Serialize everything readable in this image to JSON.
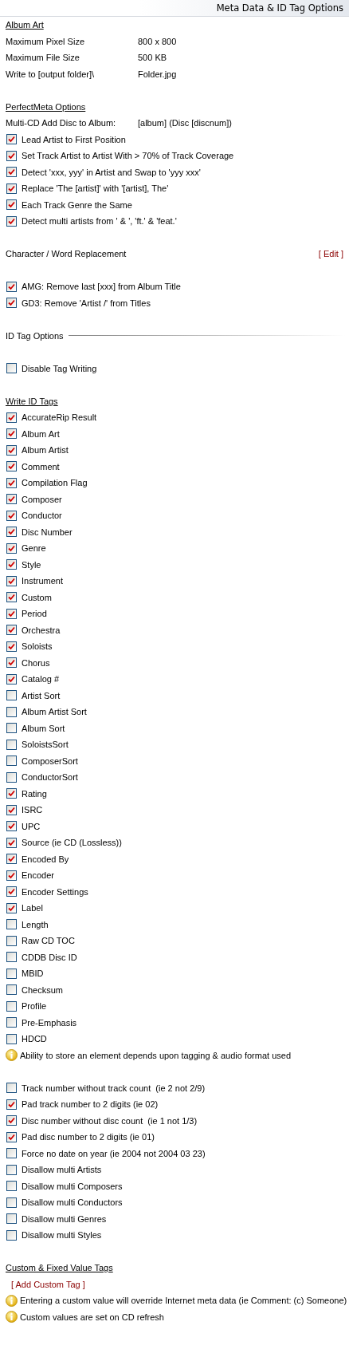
{
  "header": {
    "title": "Meta Data & ID Tag Options"
  },
  "sections": [
    {
      "items": [
        {
          "kind": "heading",
          "text": "Album Art"
        },
        {
          "kind": "field",
          "label": "Maximum Pixel Size",
          "value": "800 x 800"
        },
        {
          "kind": "field",
          "label": "Maximum File Size",
          "value": "500 KB"
        },
        {
          "kind": "field",
          "label": "Write to [output folder]\\",
          "value": "Folder.jpg"
        }
      ]
    },
    {
      "items": [
        {
          "kind": "heading",
          "text": "PerfectMeta Options"
        },
        {
          "kind": "field",
          "label": "Multi-CD Add Disc to Album:",
          "value": "[album] (Disc [discnum])"
        },
        {
          "kind": "check",
          "label": "Lead Artist to First Position",
          "checked": true
        },
        {
          "kind": "check",
          "label": "Set Track Artist to Artist With > 70% of Track Coverage",
          "checked": true
        },
        {
          "kind": "check",
          "label": "Detect 'xxx, yyy' in Artist and Swap to 'yyy xxx'",
          "checked": true
        },
        {
          "kind": "check",
          "label": "Replace 'The [artist]' with '[artist], The'",
          "checked": true
        },
        {
          "kind": "check",
          "label": "Each Track Genre the Same",
          "checked": true
        },
        {
          "kind": "check",
          "label": "Detect multi artists from ' & ', 'ft.' & 'feat.'",
          "checked": true
        }
      ]
    },
    {
      "items": [
        {
          "kind": "link_row",
          "label": "Character / Word Replacement",
          "link": "[ Edit ]"
        }
      ]
    },
    {
      "items": [
        {
          "kind": "check",
          "label": "AMG: Remove last [xxx] from Album Title",
          "checked": true
        },
        {
          "kind": "check",
          "label": "GD3: Remove 'Artist /' from Titles",
          "checked": true
        }
      ]
    },
    {
      "items": [
        {
          "kind": "rule_heading",
          "text": "ID Tag Options"
        }
      ]
    },
    {
      "items": [
        {
          "kind": "check",
          "label": "Disable Tag Writing",
          "checked": false
        }
      ]
    },
    {
      "items": [
        {
          "kind": "heading",
          "text": "Write ID Tags"
        },
        {
          "kind": "check",
          "label": "AccurateRip Result",
          "checked": true
        },
        {
          "kind": "check",
          "label": "Album Art",
          "checked": true
        },
        {
          "kind": "check",
          "label": "Album Artist",
          "checked": true
        },
        {
          "kind": "check",
          "label": "Comment",
          "checked": true
        },
        {
          "kind": "check",
          "label": "Compilation Flag",
          "checked": true
        },
        {
          "kind": "check",
          "label": "Composer",
          "checked": true
        },
        {
          "kind": "check",
          "label": "Conductor",
          "checked": true
        },
        {
          "kind": "check",
          "label": "Disc Number",
          "checked": true
        },
        {
          "kind": "check",
          "label": "Genre",
          "checked": true
        },
        {
          "kind": "check",
          "label": "Style",
          "checked": true
        },
        {
          "kind": "check",
          "label": "Instrument",
          "checked": true
        },
        {
          "kind": "check",
          "label": "Custom",
          "checked": true
        },
        {
          "kind": "check",
          "label": "Period",
          "checked": true
        },
        {
          "kind": "check",
          "label": "Orchestra",
          "checked": true
        },
        {
          "kind": "check",
          "label": "Soloists",
          "checked": true
        },
        {
          "kind": "check",
          "label": "Chorus",
          "checked": true
        },
        {
          "kind": "check",
          "label": "Catalog #",
          "checked": true
        },
        {
          "kind": "check",
          "label": "Artist Sort",
          "checked": false
        },
        {
          "kind": "check",
          "label": "Album Artist Sort",
          "checked": false
        },
        {
          "kind": "check",
          "label": "Album Sort",
          "checked": false
        },
        {
          "kind": "check",
          "label": "SoloistsSort",
          "checked": false
        },
        {
          "kind": "check",
          "label": "ComposerSort",
          "checked": false
        },
        {
          "kind": "check",
          "label": "ConductorSort",
          "checked": false
        },
        {
          "kind": "check",
          "label": "Rating",
          "checked": true
        },
        {
          "kind": "check",
          "label": "ISRC",
          "checked": true
        },
        {
          "kind": "check",
          "label": "UPC",
          "checked": true
        },
        {
          "kind": "check",
          "label": "Source (ie CD (Lossless))",
          "checked": true
        },
        {
          "kind": "check",
          "label": "Encoded By",
          "checked": true
        },
        {
          "kind": "check",
          "label": "Encoder",
          "checked": true
        },
        {
          "kind": "check",
          "label": "Encoder Settings",
          "checked": true
        },
        {
          "kind": "check",
          "label": "Label",
          "checked": true
        },
        {
          "kind": "check",
          "label": "Length",
          "checked": false
        },
        {
          "kind": "check",
          "label": "Raw CD TOC",
          "checked": false
        },
        {
          "kind": "check",
          "label": "CDDB Disc ID",
          "checked": false
        },
        {
          "kind": "check",
          "label": "MBID",
          "checked": false
        },
        {
          "kind": "check",
          "label": "Checksum",
          "checked": false
        },
        {
          "kind": "check",
          "label": "Profile",
          "checked": false
        },
        {
          "kind": "check",
          "label": "Pre-Emphasis",
          "checked": false
        },
        {
          "kind": "check",
          "label": "HDCD",
          "checked": false
        },
        {
          "kind": "note",
          "text": "Ability to store an element depends upon tagging & audio format used"
        }
      ]
    },
    {
      "items": [
        {
          "kind": "check",
          "label": "Track number without track count  (ie 2 not 2/9)",
          "checked": false
        },
        {
          "kind": "check",
          "label": "Pad track number to 2 digits (ie 02)",
          "checked": true
        },
        {
          "kind": "check",
          "label": "Disc number without disc count  (ie 1 not 1/3)",
          "checked": true
        },
        {
          "kind": "check",
          "label": "Pad disc number to 2 digits (ie 01)",
          "checked": true
        },
        {
          "kind": "check",
          "label": "Force no date on year (ie 2004 not 2004 03 23)",
          "checked": false
        },
        {
          "kind": "check",
          "label": "Disallow multi Artists",
          "checked": false
        },
        {
          "kind": "check",
          "label": "Disallow multi Composers",
          "checked": false
        },
        {
          "kind": "check",
          "label": "Disallow multi Conductors",
          "checked": false
        },
        {
          "kind": "check",
          "label": "Disallow multi Genres",
          "checked": false
        },
        {
          "kind": "check",
          "label": "Disallow multi Styles",
          "checked": false
        }
      ]
    },
    {
      "items": [
        {
          "kind": "heading",
          "text": "Custom & Fixed Value Tags"
        },
        {
          "kind": "link",
          "text": "[ Add Custom Tag ]"
        },
        {
          "kind": "note",
          "text": "Entering a custom value will override Internet meta data (ie Comment: (c) Someone)"
        },
        {
          "kind": "note",
          "text": "Custom values are set on CD refresh"
        }
      ]
    }
  ]
}
